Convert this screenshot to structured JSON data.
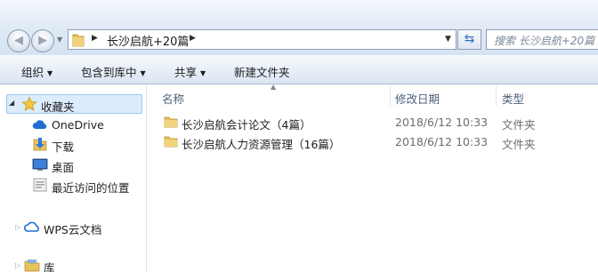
{
  "address": {
    "path": "长沙启航+20篇",
    "search_placeholder": "搜索 长沙启航+20篇"
  },
  "toolbar": {
    "organize": "组织",
    "include_in_library": "包含到库中",
    "share": "共享",
    "new_folder": "新建文件夹"
  },
  "nav": {
    "favorites": "收藏夹",
    "onedrive": "OneDrive",
    "downloads": "下载",
    "desktop": "桌面",
    "recent": "最近访问的位置",
    "wps": "WPS云文档",
    "library": "库"
  },
  "columns": {
    "name": "名称",
    "modified": "修改日期",
    "type": "类型"
  },
  "files": [
    {
      "name": "长沙启航会计论文（4篇）",
      "modified": "2018/6/12 10:33",
      "type": "文件夹"
    },
    {
      "name": "长沙启航人力资源管理（16篇）",
      "modified": "2018/6/12 10:33",
      "type": "文件夹"
    }
  ],
  "colors": {
    "folder": "#e8c25a",
    "selection": "#dcecfc",
    "header_text": "#4c607a"
  }
}
